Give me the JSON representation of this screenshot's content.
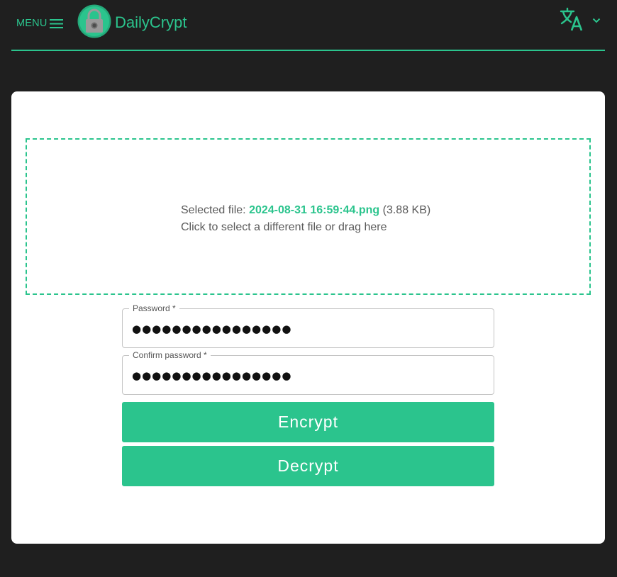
{
  "header": {
    "menu_label": "MENU",
    "brand": "DailyCrypt",
    "menu_icon": "hamburger-icon",
    "logo_icon": "padlock-icon",
    "language_icon": "translate-icon",
    "chevron_icon": "chevron-down-icon"
  },
  "dropzone": {
    "selected_prefix": "Selected file:",
    "file_name": "2024-08-31 16:59:44.png",
    "file_size": "(3.88 KB)",
    "hint": "Click to select a different file or drag here"
  },
  "password": {
    "label": "Password *",
    "value": "●●●●●●●●●●●●●●●●"
  },
  "confirm_password": {
    "label": "Confirm password *",
    "value": "●●●●●●●●●●●●●●●●"
  },
  "actions": {
    "encrypt_label": "Encrypt",
    "decrypt_label": "Decrypt"
  },
  "colors": {
    "accent": "#2bc48d",
    "background": "#1f1f1f",
    "card": "#ffffff"
  }
}
